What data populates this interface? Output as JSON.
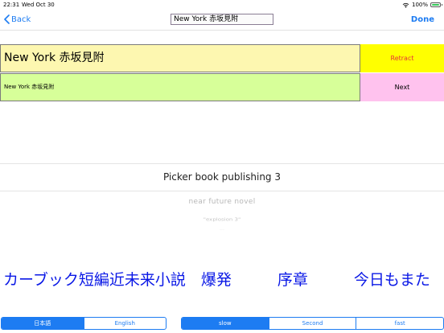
{
  "status_bar": {
    "time": "22:31",
    "date": "Wed Oct 30",
    "battery_percent": "100%",
    "icons": [
      "wifi-icon",
      "battery-icon"
    ]
  },
  "nav": {
    "back_label": "Back",
    "title_value": "New York 赤坂見附",
    "done_label": "Done",
    "accent_color": "#1d7cf2"
  },
  "main": {
    "large_text": "New York 赤坂見附",
    "retract_label": "Retract",
    "small_text": "New York 赤坂見附",
    "next_label": "Next"
  },
  "picker": {
    "selected": "Picker book publishing 3",
    "rows": [
      "near future novel",
      "\"explosion 3\"",
      "…"
    ]
  },
  "display_text": "カーブック短編近未来小説　爆発　　　序章　　　今日もまた",
  "language_segment": {
    "options": [
      "日本語",
      "English"
    ],
    "selected_index": 0
  },
  "speed_segment": {
    "options": [
      "slow",
      "Second",
      "fast"
    ],
    "selected_index": 0
  },
  "colors": {
    "main_text_bg": "#fdf7b0",
    "retract_bg": "#ffff00",
    "retract_text": "#e5303a",
    "sub_text_bg": "#d7ff99",
    "next_bg": "#ffc2ee",
    "display_text": "#0a18e6"
  }
}
